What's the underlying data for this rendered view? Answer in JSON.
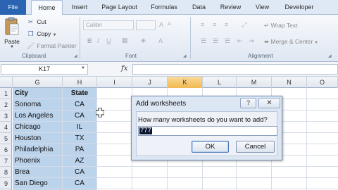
{
  "ribbon": {
    "tabs": [
      "File",
      "Home",
      "Insert",
      "Page Layout",
      "Formulas",
      "Data",
      "Review",
      "View",
      "Developer"
    ],
    "active_tab": "Home",
    "clipboard": {
      "paste_label": "Paste",
      "cut_label": "Cut",
      "copy_label": "Copy",
      "format_painter_label": "Format Painter",
      "group_label": "Clipboard"
    },
    "font": {
      "font_name": "Calibri",
      "group_label": "Font"
    },
    "alignment": {
      "wrap_text_label": "Wrap Text",
      "merge_label": "Merge & Center",
      "group_label": "Alignment"
    }
  },
  "formula_bar": {
    "name_box": "K17",
    "fx_label": "fx",
    "formula": ""
  },
  "sheet": {
    "columns": [
      "G",
      "H",
      "I",
      "J",
      "K",
      "L",
      "M",
      "N",
      "O"
    ],
    "selected_column": "K",
    "row_numbers": [
      "1",
      "2",
      "3",
      "4",
      "5",
      "6",
      "7",
      "8",
      "9"
    ],
    "headers": {
      "g": "City",
      "h": "State"
    },
    "rows": [
      {
        "city": "Sonoma",
        "state": "CA"
      },
      {
        "city": "Los Angeles",
        "state": "CA"
      },
      {
        "city": "Chicago",
        "state": "IL"
      },
      {
        "city": "Houston",
        "state": "TX"
      },
      {
        "city": "Philadelphia",
        "state": "PA"
      },
      {
        "city": "Phoenix",
        "state": "AZ"
      },
      {
        "city": "Brea",
        "state": "CA"
      },
      {
        "city": "San Diego",
        "state": "CA"
      }
    ],
    "highlight_color": "#bcd3ec",
    "selected_column_color": "#f2b94f"
  },
  "dialog": {
    "title": "Add worksheets",
    "help_label": "?",
    "close_label": "✕",
    "prompt": "How many worksheets do you want to add?",
    "input_value": "777",
    "ok_label": "OK",
    "cancel_label": "Cancel"
  },
  "icons": {
    "paste": "clipboard-icon",
    "cut": "scissors-icon",
    "copy": "copy-icon",
    "format_painter": "paintbrush-icon",
    "cursor": "cross-cursor-icon"
  }
}
